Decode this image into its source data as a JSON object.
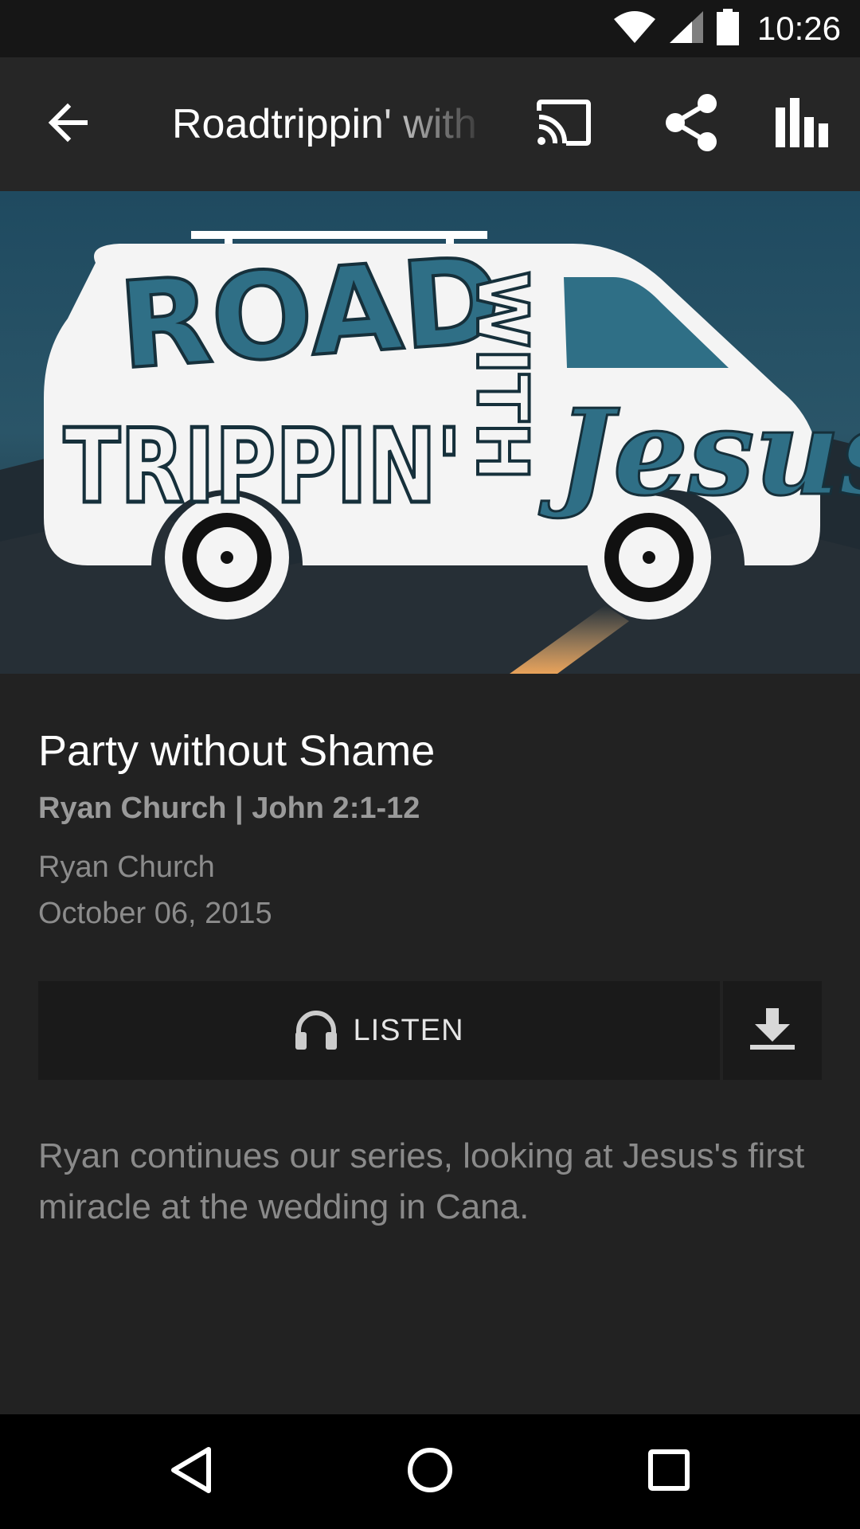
{
  "status_bar": {
    "time": "10:26",
    "icons": [
      "wifi-icon",
      "cell-signal-icon",
      "battery-icon"
    ]
  },
  "toolbar": {
    "title": "Roadtrippin' with Jesus",
    "icons": [
      "back-arrow-icon",
      "cast-icon",
      "share-icon",
      "bar-chart-icon"
    ]
  },
  "hero": {
    "artwork_text": [
      "ROAD",
      "TRIPPIN'",
      "WITH",
      "Jesus"
    ]
  },
  "episode": {
    "title": "Party without Shame",
    "subtitle": "Ryan Church | John 2:1-12",
    "speaker": "Ryan Church",
    "date": "October 06, 2015"
  },
  "actions": {
    "listen_label": "LISTEN",
    "listen_icon": "headphones-icon",
    "download_icon": "download-icon"
  },
  "description": "Ryan continues our series, looking at Jesus's first miracle at the wedding in Cana.",
  "nav_bar": {
    "icons": [
      "nav-back-icon",
      "nav-home-icon",
      "nav-recents-icon"
    ]
  },
  "colors": {
    "background": "#222222",
    "status_bar": "#161616",
    "toolbar": "#262626",
    "button": "#1a1a1a",
    "text_primary": "#ffffff",
    "text_secondary": "#8c8c8c",
    "artwork_teal": "#2f6f86"
  }
}
